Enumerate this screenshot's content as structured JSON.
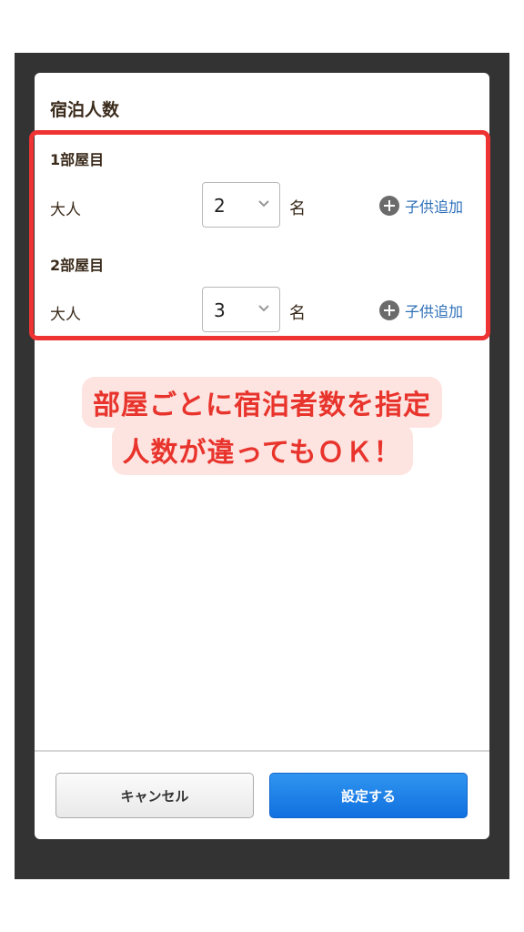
{
  "modal": {
    "title": "宿泊人数"
  },
  "rooms": [
    {
      "heading": "1部屋目",
      "adult_label": "大人",
      "adult_count": "2",
      "unit": "名",
      "add_child_label": "子供追加"
    },
    {
      "heading": "2部屋目",
      "adult_label": "大人",
      "adult_count": "3",
      "unit": "名",
      "add_child_label": "子供追加"
    }
  ],
  "callout": {
    "line1": "部屋ごとに宿泊者数を指定",
    "line2": "人数が違ってもＯＫ！"
  },
  "buttons": {
    "cancel_label": "キャンセル",
    "confirm_label": "設定する"
  },
  "colors": {
    "highlight_border": "#ee3333",
    "callout_text": "#e8342c",
    "callout_bg": "#fde4e1",
    "link_blue": "#2d6fb8",
    "confirm_button": "#1a7fe8",
    "frame_dark": "#333333"
  },
  "icons": {
    "add_child": "plus-circle-icon",
    "select_arrow": "chevron-down-icon"
  }
}
